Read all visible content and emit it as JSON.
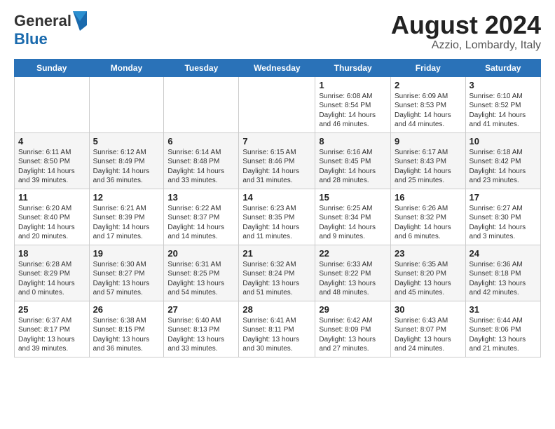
{
  "header": {
    "logo_general": "General",
    "logo_blue": "Blue",
    "title": "August 2024",
    "subtitle": "Azzio, Lombardy, Italy"
  },
  "weekdays": [
    "Sunday",
    "Monday",
    "Tuesday",
    "Wednesday",
    "Thursday",
    "Friday",
    "Saturday"
  ],
  "weeks": [
    [
      {
        "day": "",
        "info": ""
      },
      {
        "day": "",
        "info": ""
      },
      {
        "day": "",
        "info": ""
      },
      {
        "day": "",
        "info": ""
      },
      {
        "day": "1",
        "info": "Sunrise: 6:08 AM\nSunset: 8:54 PM\nDaylight: 14 hours and 46 minutes."
      },
      {
        "day": "2",
        "info": "Sunrise: 6:09 AM\nSunset: 8:53 PM\nDaylight: 14 hours and 44 minutes."
      },
      {
        "day": "3",
        "info": "Sunrise: 6:10 AM\nSunset: 8:52 PM\nDaylight: 14 hours and 41 minutes."
      }
    ],
    [
      {
        "day": "4",
        "info": "Sunrise: 6:11 AM\nSunset: 8:50 PM\nDaylight: 14 hours and 39 minutes."
      },
      {
        "day": "5",
        "info": "Sunrise: 6:12 AM\nSunset: 8:49 PM\nDaylight: 14 hours and 36 minutes."
      },
      {
        "day": "6",
        "info": "Sunrise: 6:14 AM\nSunset: 8:48 PM\nDaylight: 14 hours and 33 minutes."
      },
      {
        "day": "7",
        "info": "Sunrise: 6:15 AM\nSunset: 8:46 PM\nDaylight: 14 hours and 31 minutes."
      },
      {
        "day": "8",
        "info": "Sunrise: 6:16 AM\nSunset: 8:45 PM\nDaylight: 14 hours and 28 minutes."
      },
      {
        "day": "9",
        "info": "Sunrise: 6:17 AM\nSunset: 8:43 PM\nDaylight: 14 hours and 25 minutes."
      },
      {
        "day": "10",
        "info": "Sunrise: 6:18 AM\nSunset: 8:42 PM\nDaylight: 14 hours and 23 minutes."
      }
    ],
    [
      {
        "day": "11",
        "info": "Sunrise: 6:20 AM\nSunset: 8:40 PM\nDaylight: 14 hours and 20 minutes."
      },
      {
        "day": "12",
        "info": "Sunrise: 6:21 AM\nSunset: 8:39 PM\nDaylight: 14 hours and 17 minutes."
      },
      {
        "day": "13",
        "info": "Sunrise: 6:22 AM\nSunset: 8:37 PM\nDaylight: 14 hours and 14 minutes."
      },
      {
        "day": "14",
        "info": "Sunrise: 6:23 AM\nSunset: 8:35 PM\nDaylight: 14 hours and 11 minutes."
      },
      {
        "day": "15",
        "info": "Sunrise: 6:25 AM\nSunset: 8:34 PM\nDaylight: 14 hours and 9 minutes."
      },
      {
        "day": "16",
        "info": "Sunrise: 6:26 AM\nSunset: 8:32 PM\nDaylight: 14 hours and 6 minutes."
      },
      {
        "day": "17",
        "info": "Sunrise: 6:27 AM\nSunset: 8:30 PM\nDaylight: 14 hours and 3 minutes."
      }
    ],
    [
      {
        "day": "18",
        "info": "Sunrise: 6:28 AM\nSunset: 8:29 PM\nDaylight: 14 hours and 0 minutes."
      },
      {
        "day": "19",
        "info": "Sunrise: 6:30 AM\nSunset: 8:27 PM\nDaylight: 13 hours and 57 minutes."
      },
      {
        "day": "20",
        "info": "Sunrise: 6:31 AM\nSunset: 8:25 PM\nDaylight: 13 hours and 54 minutes."
      },
      {
        "day": "21",
        "info": "Sunrise: 6:32 AM\nSunset: 8:24 PM\nDaylight: 13 hours and 51 minutes."
      },
      {
        "day": "22",
        "info": "Sunrise: 6:33 AM\nSunset: 8:22 PM\nDaylight: 13 hours and 48 minutes."
      },
      {
        "day": "23",
        "info": "Sunrise: 6:35 AM\nSunset: 8:20 PM\nDaylight: 13 hours and 45 minutes."
      },
      {
        "day": "24",
        "info": "Sunrise: 6:36 AM\nSunset: 8:18 PM\nDaylight: 13 hours and 42 minutes."
      }
    ],
    [
      {
        "day": "25",
        "info": "Sunrise: 6:37 AM\nSunset: 8:17 PM\nDaylight: 13 hours and 39 minutes."
      },
      {
        "day": "26",
        "info": "Sunrise: 6:38 AM\nSunset: 8:15 PM\nDaylight: 13 hours and 36 minutes."
      },
      {
        "day": "27",
        "info": "Sunrise: 6:40 AM\nSunset: 8:13 PM\nDaylight: 13 hours and 33 minutes."
      },
      {
        "day": "28",
        "info": "Sunrise: 6:41 AM\nSunset: 8:11 PM\nDaylight: 13 hours and 30 minutes."
      },
      {
        "day": "29",
        "info": "Sunrise: 6:42 AM\nSunset: 8:09 PM\nDaylight: 13 hours and 27 minutes."
      },
      {
        "day": "30",
        "info": "Sunrise: 6:43 AM\nSunset: 8:07 PM\nDaylight: 13 hours and 24 minutes."
      },
      {
        "day": "31",
        "info": "Sunrise: 6:44 AM\nSunset: 8:06 PM\nDaylight: 13 hours and 21 minutes."
      }
    ]
  ]
}
